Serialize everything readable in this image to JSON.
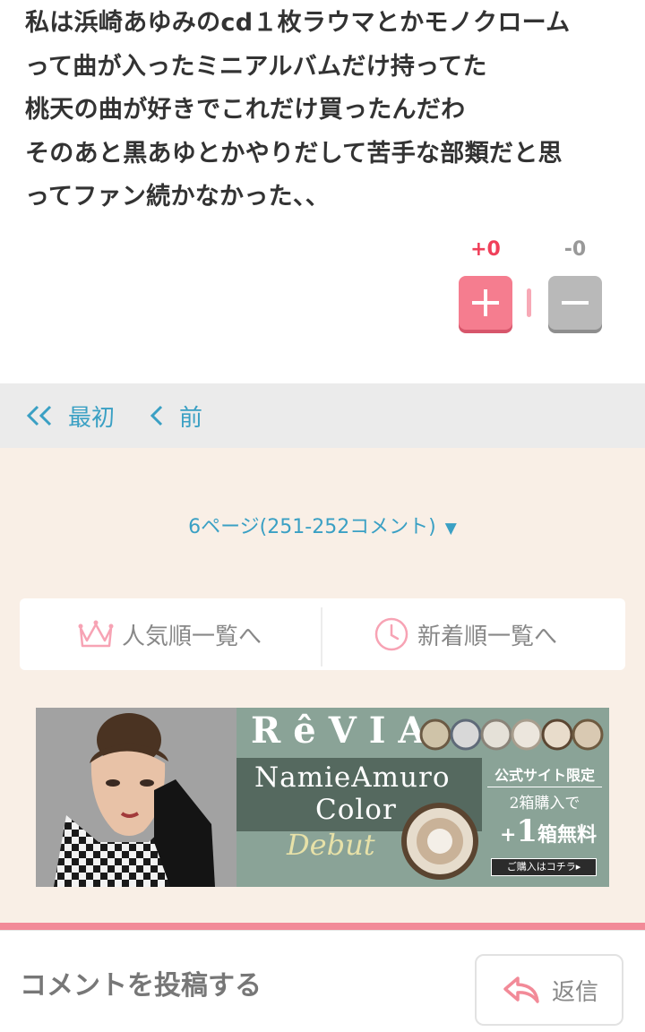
{
  "comment": {
    "lines": [
      "私は浜崎あゆみのcd１枚ラウマとかモノクローム",
      "って曲が入ったミニアルバムだけ持ってた",
      "桃天の曲が好きでこれだけ買ったんだわ",
      "そのあと黒あゆとかやりだして苦手な部類だと思",
      "ってファン続かなかった、、"
    ],
    "plus_count": "+0",
    "minus_count": "-0"
  },
  "pager": {
    "first_label": "最初",
    "prev_label": "前"
  },
  "page_select": {
    "label": "6ページ(251-252コメント)",
    "arrow": "▼"
  },
  "sort": {
    "popular_label": "人気順一覧へ",
    "new_label": "新着順一覧へ"
  },
  "ad": {
    "brand": "RêVIA",
    "name": "NamieAmuro",
    "color_word": "Color",
    "debut": "Debut",
    "limited": "公式サイト限定",
    "two_boxes": "2箱購入で",
    "free_plus": "+",
    "free_one": "1",
    "free_rest": "箱無料",
    "buy": "ご購入はコチラ▸"
  },
  "post": {
    "label": "コメントを投稿する",
    "reply_label": "返信"
  },
  "colors": {
    "accent_blue": "#3aa0c4",
    "plus_pink": "#f57d8f",
    "plus_count": "#f0405a",
    "minus_gray": "#b9b9b9",
    "bg_cream": "#f9efe6",
    "icon_pink": "#f7a3b4"
  },
  "icons": {
    "first": "double-chevron-left-icon",
    "prev": "chevron-left-icon",
    "popular": "crown-icon",
    "new": "clock-icon",
    "reply": "reply-arrow-icon",
    "plus": "plus-icon",
    "minus": "minus-icon"
  }
}
